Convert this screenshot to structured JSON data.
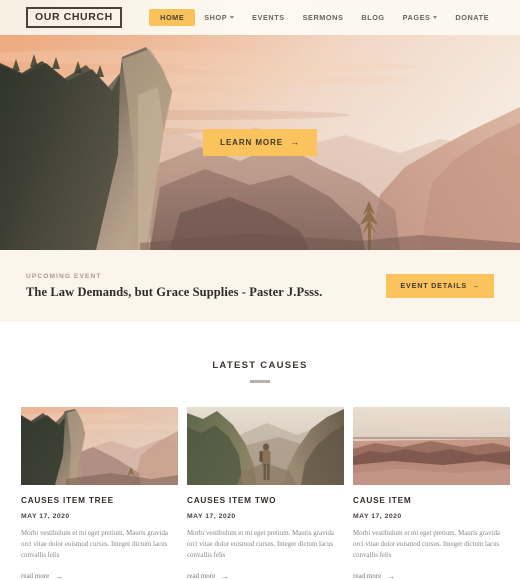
{
  "header": {
    "logo": "OUR CHURCH",
    "nav": [
      {
        "label": "HOME",
        "active": true,
        "caret": false
      },
      {
        "label": "SHOP",
        "active": false,
        "caret": true
      },
      {
        "label": "EVENTS",
        "active": false,
        "caret": false
      },
      {
        "label": "SERMONS",
        "active": false,
        "caret": false
      },
      {
        "label": "BLOG",
        "active": false,
        "caret": false
      },
      {
        "label": "PAGES",
        "active": false,
        "caret": true
      },
      {
        "label": "DONATE",
        "active": false,
        "caret": false
      }
    ]
  },
  "hero": {
    "cta_label": "LEARN MORE",
    "cta_arrow": "→",
    "image_alt": "sunset-mountain-valley-photo"
  },
  "event": {
    "kicker": "UPCOMING EVENT",
    "title": "The Law Demands, but Grace Supplies - Paster J.Psss.",
    "button_label": "EVENT DETAILS",
    "button_arrow": "→"
  },
  "causes": {
    "section_title": "LATEST CAUSES",
    "read_more_label": "read more",
    "read_more_arrow": "→",
    "items": [
      {
        "title": "CAUSES ITEM TREE",
        "date": "MAY 17, 2020",
        "excerpt": "Morbi vestibulum et mi eget pretium. Mauris gravida orci vitae dolor euismod cursus. Integer dictum lacus convallis felis",
        "image_alt": "mountain-canyon-sunset-photo"
      },
      {
        "title": "CAUSES ITEM TWO",
        "date": "MAY 17, 2020",
        "excerpt": "Morbi vestibulum et mi eget pretium. Mauris gravida orci vitae dolor euismod cursus. Integer dictum lacus convallis felis",
        "image_alt": "hiker-with-backpack-in-valley-photo"
      },
      {
        "title": "CAUSE ITEM",
        "date": "MAY 17, 2020",
        "excerpt": "Morbi vestibulum et mi eget pretium. Mauris gravida orci vitae dolor euismod cursus. Integer dictum lacus convallis felis",
        "image_alt": "desert-dunes-at-dusk-photo"
      }
    ]
  },
  "colors": {
    "accent_yellow": "#fac35d",
    "header_cream": "#fdf6ec",
    "event_cream": "#fbf5ec",
    "text_dark": "#332c28",
    "text_muted": "#8d8681"
  }
}
